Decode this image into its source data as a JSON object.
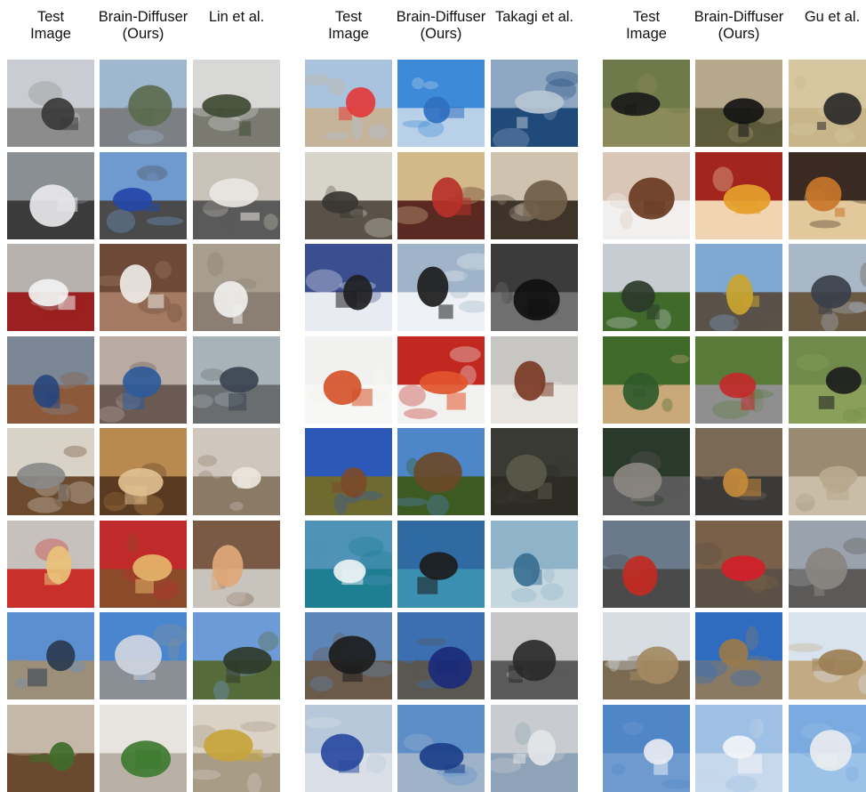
{
  "panels": [
    {
      "headers": [
        "Test\nImage",
        "Brain-Diffuser\n(Ours)",
        "Lin et al."
      ],
      "rows": [
        {
          "scene": "street-crowd",
          "tiles": [
            {
              "sky": "#c9cdd3",
              "ground": "#8c8c8c",
              "blob": "#3a3a3a"
            },
            {
              "sky": "#9fb7cf",
              "ground": "#7c7f84",
              "blob": "#5b6b4f"
            },
            {
              "sky": "#d8d8d6",
              "ground": "#7a7a70",
              "blob": "#3f4a33"
            }
          ]
        },
        {
          "scene": "truck",
          "tiles": [
            {
              "sky": "#8a8f93",
              "ground": "#3b3b3b",
              "blob": "#e8e8ea"
            },
            {
              "sky": "#6f9ad0",
              "ground": "#4a4a4a",
              "blob": "#2447a8"
            },
            {
              "sky": "#c8c2b8",
              "ground": "#5a5a5a",
              "blob": "#e9e7e2"
            }
          ]
        },
        {
          "scene": "toilet",
          "tiles": [
            {
              "sky": "#b7b2ae",
              "ground": "#9b2020",
              "blob": "#f2f2f2"
            },
            {
              "sky": "#6d4a38",
              "ground": "#a47a62",
              "blob": "#efeae6"
            },
            {
              "sky": "#a89e90",
              "ground": "#8a7f72",
              "blob": "#efefec"
            }
          ]
        },
        {
          "scene": "person-gift",
          "tiles": [
            {
              "sky": "#7b8794",
              "ground": "#8c5a3a",
              "blob": "#28457d"
            },
            {
              "sky": "#b9aba2",
              "ground": "#6a5a52",
              "blob": "#2e5b9a"
            },
            {
              "sky": "#a7b3b8",
              "ground": "#6a6d70",
              "blob": "#3b4450"
            }
          ]
        },
        {
          "scene": "kitchen",
          "tiles": [
            {
              "sky": "#d9d2c6",
              "ground": "#6b4a2e",
              "blob": "#8a8a8a"
            },
            {
              "sky": "#b98a50",
              "ground": "#5a3a20",
              "blob": "#e0c090"
            },
            {
              "sky": "#cfc7bd",
              "ground": "#8b7a66",
              "blob": "#ece6dc"
            }
          ]
        },
        {
          "scene": "pizza",
          "tiles": [
            {
              "sky": "#c7c1bd",
              "ground": "#c9302c",
              "blob": "#e9c27a"
            },
            {
              "sky": "#c02a2a",
              "ground": "#8b4a2a",
              "blob": "#e5b56a"
            },
            {
              "sky": "#7a5a44",
              "ground": "#c8c4bc",
              "blob": "#e0a87a"
            }
          ]
        },
        {
          "scene": "kite-beach",
          "tiles": [
            {
              "sky": "#5c8fd0",
              "ground": "#9c8f7a",
              "blob": "#2b3b4f"
            },
            {
              "sky": "#4a86cf",
              "ground": "#8a8f96",
              "blob": "#cfd6de"
            },
            {
              "sky": "#6d9bd8",
              "ground": "#556b3a",
              "blob": "#2f3b2a"
            }
          ]
        },
        {
          "scene": "plant-vase",
          "tiles": [
            {
              "sky": "#c5b8a8",
              "ground": "#6a4a2f",
              "blob": "#3f6b2a"
            },
            {
              "sky": "#e7e3de",
              "ground": "#b9b1a6",
              "blob": "#3d7a30"
            },
            {
              "sky": "#d9d2c5",
              "ground": "#a89c87",
              "blob": "#c7a43a"
            }
          ]
        }
      ]
    },
    {
      "headers": [
        "Test\nImage",
        "Brain-Diffuser\n(Ours)",
        "Takagi et al."
      ],
      "rows": [
        {
          "scene": "kites-beach",
          "tiles": [
            {
              "sky": "#a9c3df",
              "ground": "#c5b49a",
              "blob": "#e23b3b"
            },
            {
              "sky": "#3d8ad8",
              "ground": "#b9d1e8",
              "blob": "#2f6fc0"
            },
            {
              "sky": "#8ea7c2",
              "ground": "#1f4a7a",
              "blob": "#b7c5d3"
            }
          ]
        },
        {
          "scene": "cafe-crowd",
          "tiles": [
            {
              "sky": "#d7d4c9",
              "ground": "#5a5248",
              "blob": "#3a3632"
            },
            {
              "sky": "#d3b88a",
              "ground": "#5a2a22",
              "blob": "#b8302a"
            },
            {
              "sky": "#cfc3b0",
              "ground": "#3e342a",
              "blob": "#6f5d48"
            }
          ]
        },
        {
          "scene": "skier",
          "tiles": [
            {
              "sky": "#3b4e8f",
              "ground": "#e8ecf2",
              "blob": "#1f1f22"
            },
            {
              "sky": "#9fb4c8",
              "ground": "#eef1f5",
              "blob": "#1c1c1c"
            },
            {
              "sky": "#3b3b3b",
              "ground": "#6f6f6f",
              "blob": "#101010"
            }
          ]
        },
        {
          "scene": "salad-bowl",
          "tiles": [
            {
              "sky": "#f1f1ef",
              "ground": "#f7f7f5",
              "blob": "#d5522a"
            },
            {
              "sky": "#c2281f",
              "ground": "#f2f2f0",
              "blob": "#e2542c"
            },
            {
              "sky": "#c8c6c2",
              "ground": "#e9e6e1",
              "blob": "#7a3a24"
            }
          ]
        },
        {
          "scene": "horses-field",
          "tiles": [
            {
              "sky": "#2c58b8",
              "ground": "#6f6a2f",
              "blob": "#7a4a2a"
            },
            {
              "sky": "#4d86c9",
              "ground": "#3c5a22",
              "blob": "#6a4a2a"
            },
            {
              "sky": "#3a3a34",
              "ground": "#2c2c24",
              "blob": "#5a5a4a"
            }
          ]
        },
        {
          "scene": "surfer",
          "tiles": [
            {
              "sky": "#4f93b8",
              "ground": "#1e7f92",
              "blob": "#e9f2f4"
            },
            {
              "sky": "#2f6aa3",
              "ground": "#3b8fb0",
              "blob": "#1c1c1c"
            },
            {
              "sky": "#8fb3c8",
              "ground": "#c7d7df",
              "blob": "#3a6f93"
            }
          ]
        },
        {
          "scene": "train",
          "tiles": [
            {
              "sky": "#5c86b8",
              "ground": "#6a5a4a",
              "blob": "#1c1c1c"
            },
            {
              "sky": "#3b6fb2",
              "ground": "#5a5650",
              "blob": "#1a2a7a"
            },
            {
              "sky": "#c6c6c6",
              "ground": "#5a5a5a",
              "blob": "#2a2a2a"
            }
          ]
        },
        {
          "scene": "airplane",
          "tiles": [
            {
              "sky": "#b7c8da",
              "ground": "#d9dfe6",
              "blob": "#2a4aa0"
            },
            {
              "sky": "#5d8ec8",
              "ground": "#9fb3c8",
              "blob": "#1c3f8a"
            },
            {
              "sky": "#c8ccd0",
              "ground": "#8fa3b8",
              "blob": "#e3e5e8"
            }
          ]
        }
      ]
    },
    {
      "headers": [
        "Test\nImage",
        "Brain-Diffuser\n(Ours)",
        "Gu et al."
      ],
      "rows": [
        {
          "scene": "zebra",
          "tiles": [
            {
              "sky": "#6f7a4a",
              "ground": "#8b8a5a",
              "blob": "#1a1a1a"
            },
            {
              "sky": "#b6a88a",
              "ground": "#5d5a3a",
              "blob": "#151515"
            },
            {
              "sky": "#d7c7a0",
              "ground": "#c8b58a",
              "blob": "#2a2a2a"
            }
          ]
        },
        {
          "scene": "plate-food",
          "tiles": [
            {
              "sky": "#d9c6b6",
              "ground": "#f2f0ee",
              "blob": "#6a3a22"
            },
            {
              "sky": "#a2261e",
              "ground": "#f2d4b2",
              "blob": "#e5a02a"
            },
            {
              "sky": "#3a2a22",
              "ground": "#e2c89a",
              "blob": "#c8762a"
            }
          ]
        },
        {
          "scene": "train-tracks",
          "tiles": [
            {
              "sky": "#c7ccd2",
              "ground": "#3f6a2a",
              "blob": "#2a3b2a"
            },
            {
              "sky": "#7fa8d2",
              "ground": "#5a5148",
              "blob": "#c9a52f"
            },
            {
              "sky": "#a9b8c6",
              "ground": "#6a5a44",
              "blob": "#3a3f4a"
            }
          ]
        },
        {
          "scene": "baseball",
          "tiles": [
            {
              "sky": "#3f6a2a",
              "ground": "#c9a87a",
              "blob": "#2f5a2a"
            },
            {
              "sky": "#5a7a3a",
              "ground": "#8f8f8f",
              "blob": "#c22a2a"
            },
            {
              "sky": "#6f8a4a",
              "ground": "#8aa05a",
              "blob": "#1c1c1c"
            }
          ]
        },
        {
          "scene": "cat",
          "tiles": [
            {
              "sky": "#2a3a2a",
              "ground": "#5a5a5a",
              "blob": "#8a8580"
            },
            {
              "sky": "#7a6a55",
              "ground": "#3c3a38",
              "blob": "#c48a3a"
            },
            {
              "sky": "#9a8a72",
              "ground": "#c9bda8",
              "blob": "#b8a88c"
            }
          ]
        },
        {
          "scene": "bus-street",
          "tiles": [
            {
              "sky": "#6a7a8c",
              "ground": "#4a4a4a",
              "blob": "#c22a22"
            },
            {
              "sky": "#7a6048",
              "ground": "#5a5046",
              "blob": "#d4202a"
            },
            {
              "sky": "#9aa3ad",
              "ground": "#5c5a58",
              "blob": "#8a8580"
            }
          ]
        },
        {
          "scene": "clock-tower",
          "tiles": [
            {
              "sky": "#d8dde3",
              "ground": "#7a6a52",
              "blob": "#a38a62"
            },
            {
              "sky": "#2f6cc0",
              "ground": "#8a7a64",
              "blob": "#9a7a4a"
            },
            {
              "sky": "#d9e3ee",
              "ground": "#c2ab84",
              "blob": "#9c7f56"
            }
          ]
        },
        {
          "scene": "airplane-sky",
          "tiles": [
            {
              "sky": "#4f86c6",
              "ground": "#6f9ad0",
              "blob": "#e8ecf2"
            },
            {
              "sky": "#9ec0e4",
              "ground": "#c6d8ec",
              "blob": "#f2f4f7"
            },
            {
              "sky": "#7aaadf",
              "ground": "#9cc2e8",
              "blob": "#e9ecef"
            }
          ]
        }
      ]
    }
  ]
}
